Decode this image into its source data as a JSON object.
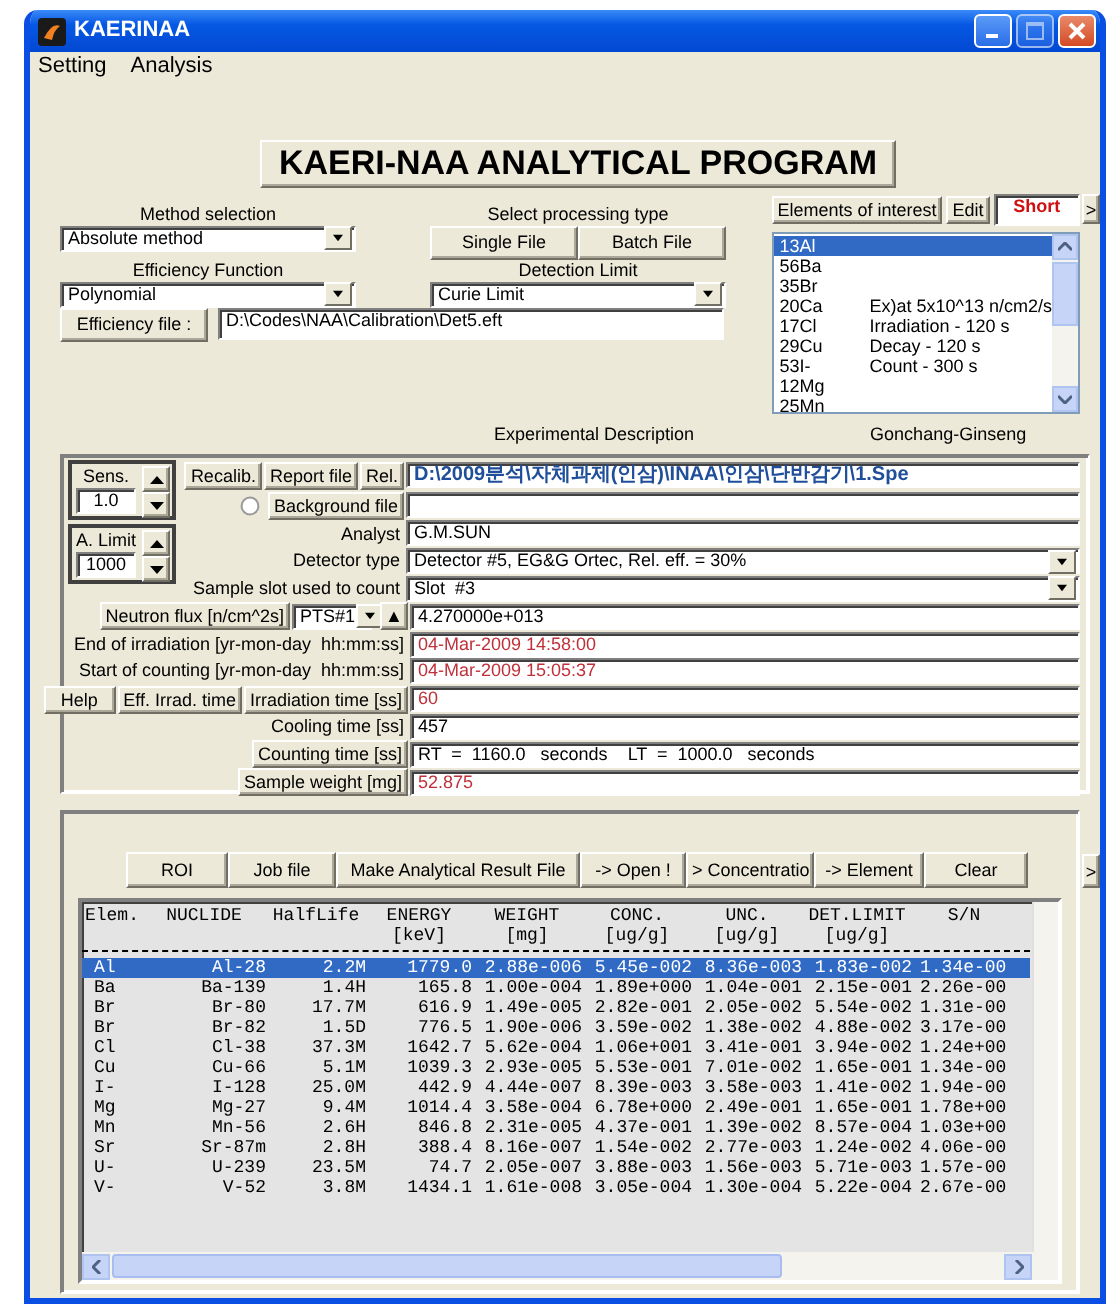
{
  "window": {
    "title": "KAERINAA"
  },
  "menu": [
    "Setting",
    "Analysis"
  ],
  "program_title": "KAERI-NAA ANALYTICAL PROGRAM",
  "method_selection": {
    "label": "Method selection",
    "value": "Absolute method"
  },
  "efficiency_function": {
    "label": "Efficiency Function",
    "value": "Polynomial"
  },
  "efficiency_file": {
    "button": "Efficiency file :",
    "value": "D:\\Codes\\NAA\\Calibration\\Det5.eft"
  },
  "processing_type": {
    "label": "Select processing type",
    "buttons": [
      "Single File",
      "Batch File"
    ]
  },
  "detection_limit": {
    "label": "Detection Limit",
    "value": "Curie Limit"
  },
  "elements_panel": {
    "buttons": [
      "Elements of interest",
      "Edit"
    ],
    "mode": "Short",
    "more": ">",
    "items": [
      {
        "label": "13Al",
        "selected": true
      },
      {
        "label": "56Ba",
        "selected": false
      },
      {
        "label": "35Br",
        "selected": false
      },
      {
        "label": "20Ca",
        "note": "Ex)at 5x10^13 n/cm2/s",
        "selected": false
      },
      {
        "label": "17Cl",
        "note": "Irradiation - 120 s",
        "selected": false
      },
      {
        "label": "29Cu",
        "note": "Decay - 120 s",
        "selected": false
      },
      {
        "label": "53I-",
        "note": "Count - 300 s",
        "selected": false
      },
      {
        "label": "12Mg",
        "selected": false
      },
      {
        "label": "25Mn",
        "selected": false
      }
    ]
  },
  "experimental_description": "Experimental Description",
  "sample_name": "Gonchang-Ginseng",
  "sens": {
    "label": "Sens.",
    "value": "1.0"
  },
  "a_limit": {
    "label": "A. Limit",
    "value": "1000"
  },
  "spectrum": {
    "buttons": [
      "Recalib.",
      "Report file",
      "Rel."
    ],
    "path": "D:\\2009분석\\자체과제(인삼)\\INAA\\인삼\\단반감기\\1.Spe"
  },
  "background": {
    "selected": false,
    "button": "Background file"
  },
  "fields": [
    {
      "kind": "text",
      "label": "Analyst",
      "value": "G.M.SUN",
      "color": "#000000"
    },
    {
      "kind": "select",
      "label": "Detector type",
      "value": "Detector #5, EG&G Ortec, Rel. eff. = 30%",
      "color": "#000000"
    },
    {
      "kind": "select",
      "label": "Sample slot used to count",
      "value": "Slot  #3",
      "color": "#000000"
    },
    {
      "kind": "flux",
      "label": "Neutron flux [n/cm^2s]",
      "source": "PTS#1",
      "arrow": "▲",
      "value": "4.270000e+013",
      "color": "#000000"
    },
    {
      "kind": "text",
      "label": "End of irradiation [yr-mon-day  hh:mm:ss]",
      "value": "04-Mar-2009 14:58:00",
      "color": "#c0303a"
    },
    {
      "kind": "text",
      "label": "Start of counting [yr-mon-day  hh:mm:ss]",
      "value": "04-Mar-2009 15:05:37",
      "color": "#c0303a"
    },
    {
      "kind": "button",
      "label": "Irradiation time [ss]",
      "value": "60",
      "color": "#c0303a",
      "extra_buttons": [
        "Help",
        "Eff. Irrad. time"
      ]
    },
    {
      "kind": "text",
      "label": "Cooling time [ss]",
      "value": "457",
      "color": "#000000"
    },
    {
      "kind": "button",
      "label": "Counting time [ss]",
      "value": "RT  =  1160.0   seconds    LT  =  1000.0   seconds",
      "color": "#000000"
    },
    {
      "kind": "button",
      "label": "Sample weight [mg]",
      "value": "52.875",
      "color": "#c0303a"
    }
  ],
  "result_buttons": [
    "ROI",
    "Job file",
    "Make Analytical Result File",
    "-> Open !",
    "> Concentratio",
    "-> Element",
    "Clear"
  ],
  "result_more": ">",
  "table": {
    "columns": [
      {
        "label": "Elem."
      },
      {
        "label": "NUCLIDE"
      },
      {
        "label": "HalfLife"
      },
      {
        "label": "ENERGY",
        "unit": "[keV]"
      },
      {
        "label": "WEIGHT",
        "unit": "[mg]"
      },
      {
        "label": "CONC.",
        "unit": "[ug/g]"
      },
      {
        "label": "UNC.",
        "unit": "[ug/g]"
      },
      {
        "label": "DET.LIMIT",
        "unit": "[ug/g]"
      },
      {
        "label": "S/N"
      }
    ],
    "rows": [
      {
        "selected": true,
        "cells": [
          "Al",
          "Al-28",
          "2.2M",
          "1779.0",
          "2.88e-006",
          "5.45e-002",
          "8.36e-003",
          "1.83e-002",
          "1.34e-00"
        ]
      },
      {
        "selected": false,
        "cells": [
          "Ba",
          "Ba-139",
          "1.4H",
          "165.8",
          "1.00e-004",
          "1.89e+000",
          "1.04e-001",
          "2.15e-001",
          "2.26e-00"
        ]
      },
      {
        "selected": false,
        "cells": [
          "Br",
          "Br-80",
          "17.7M",
          "616.9",
          "1.49e-005",
          "2.82e-001",
          "2.05e-002",
          "5.54e-002",
          "1.31e-00"
        ]
      },
      {
        "selected": false,
        "cells": [
          "Br",
          "Br-82",
          "1.5D",
          "776.5",
          "1.90e-006",
          "3.59e-002",
          "1.38e-002",
          "4.88e-002",
          "3.17e-00"
        ]
      },
      {
        "selected": false,
        "cells": [
          "Cl",
          "Cl-38",
          "37.3M",
          "1642.7",
          "5.62e-004",
          "1.06e+001",
          "3.41e-001",
          "3.94e-002",
          "1.24e+00"
        ]
      },
      {
        "selected": false,
        "cells": [
          "Cu",
          "Cu-66",
          "5.1M",
          "1039.3",
          "2.93e-005",
          "5.53e-001",
          "7.01e-002",
          "1.65e-001",
          "1.34e-00"
        ]
      },
      {
        "selected": false,
        "cells": [
          "I-",
          "I-128",
          "25.0M",
          "442.9",
          "4.44e-007",
          "8.39e-003",
          "3.58e-003",
          "1.41e-002",
          "1.94e-00"
        ]
      },
      {
        "selected": false,
        "cells": [
          "Mg",
          "Mg-27",
          "9.4M",
          "1014.4",
          "3.58e-004",
          "6.78e+000",
          "2.49e-001",
          "1.65e-001",
          "1.78e+00"
        ]
      },
      {
        "selected": false,
        "cells": [
          "Mn",
          "Mn-56",
          "2.6H",
          "846.8",
          "2.31e-005",
          "4.37e-001",
          "1.39e-002",
          "8.57e-004",
          "1.03e+00"
        ]
      },
      {
        "selected": false,
        "cells": [
          "Sr",
          "Sr-87m",
          "2.8H",
          "388.4",
          "8.16e-007",
          "1.54e-002",
          "2.77e-003",
          "1.24e-002",
          "4.06e-00"
        ]
      },
      {
        "selected": false,
        "cells": [
          "U-",
          "U-239",
          "23.5M",
          "74.7",
          "2.05e-007",
          "3.88e-003",
          "1.56e-003",
          "5.71e-003",
          "1.57e-00"
        ]
      },
      {
        "selected": false,
        "cells": [
          "V-",
          "V-52",
          "3.8M",
          "1434.1",
          "1.61e-008",
          "3.05e-004",
          "1.30e-004",
          "5.22e-004",
          "2.67e-00"
        ]
      }
    ]
  }
}
